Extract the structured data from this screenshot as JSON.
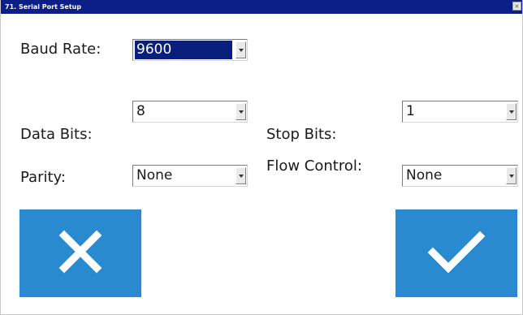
{
  "window": {
    "title": "71. Serial Port Setup",
    "close_glyph": "×"
  },
  "fields": {
    "baud_rate": {
      "label": "Baud Rate:",
      "value": "9600"
    },
    "data_bits": {
      "label": "Data Bits:",
      "value": "8"
    },
    "stop_bits": {
      "label": "Stop Bits:",
      "value": "1"
    },
    "parity": {
      "label": "Parity:",
      "value": "None"
    },
    "flow_control": {
      "label": "Flow Control:",
      "value": "None"
    }
  },
  "buttons": {
    "cancel_icon": "x-icon",
    "confirm_icon": "checkmark-icon",
    "color": "#2a8ad0"
  },
  "colors": {
    "titlebar": "#0b1f86",
    "selection": "#0a1e7c"
  }
}
